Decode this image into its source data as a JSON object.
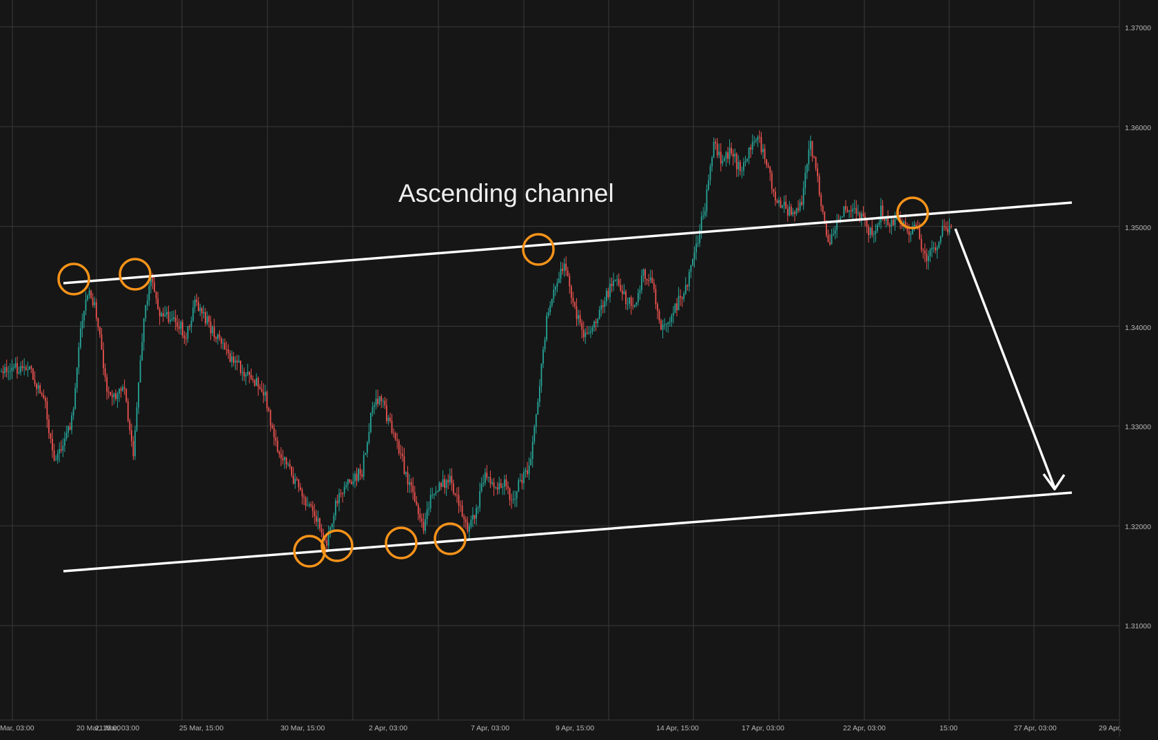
{
  "colors": {
    "background": "#161616",
    "grid": "#3a3a3a",
    "axis_text": "#b8b8b8",
    "bull_candle": "#26a69a",
    "bear_candle": "#ef5350",
    "channel_line": "#ffffff",
    "touch_marker": "#f7931a",
    "annotation_text": "#eeeeee"
  },
  "chart_data": {
    "type": "candlestick",
    "title": "",
    "annotations": [
      {
        "text": "Ascending channel"
      }
    ],
    "y_axis": {
      "position": "right",
      "range": [
        1.3,
        1.372
      ],
      "ticks": [
        "1.37000",
        "1.36000",
        "1.35000",
        "1.34000",
        "1.33000",
        "1.32000",
        "1.31000"
      ]
    },
    "x_axis": {
      "labels": [
        "Mar, 03:00",
        "20 Mar, 15:00",
        "21 Mar, 03:00",
        "25 Mar, 15:00",
        "30 Mar, 15:00",
        "2 Apr, 03:00",
        "7 Apr, 03:00",
        "9 Apr, 15:00",
        "14 Apr, 15:00",
        "17 Apr, 03:00",
        "22 Apr, 03:00",
        "15:00",
        "27 Apr, 03:00",
        "29 Apr,"
      ]
    },
    "grid": true,
    "price_path": [
      [
        0,
        1.3355
      ],
      [
        3,
        1.336
      ],
      [
        5,
        1.332
      ],
      [
        6,
        1.3265
      ],
      [
        7,
        1.3285
      ],
      [
        8,
        1.3305
      ],
      [
        9,
        1.3395
      ],
      [
        10,
        1.344
      ],
      [
        11,
        1.3405
      ],
      [
        12,
        1.333
      ],
      [
        14,
        1.3335
      ],
      [
        15,
        1.327
      ],
      [
        16,
        1.339
      ],
      [
        17,
        1.3455
      ],
      [
        18,
        1.3415
      ],
      [
        20,
        1.3405
      ],
      [
        21,
        1.339
      ],
      [
        22,
        1.3425
      ],
      [
        24,
        1.3395
      ],
      [
        26,
        1.337
      ],
      [
        28,
        1.335
      ],
      [
        29,
        1.3345
      ],
      [
        30,
        1.333
      ],
      [
        31,
        1.3285
      ],
      [
        33,
        1.325
      ],
      [
        35,
        1.322
      ],
      [
        36,
        1.3205
      ],
      [
        37,
        1.318
      ],
      [
        38,
        1.3225
      ],
      [
        39,
        1.324
      ],
      [
        41,
        1.3255
      ],
      [
        42,
        1.331
      ],
      [
        43,
        1.333
      ],
      [
        44,
        1.3305
      ],
      [
        45,
        1.3285
      ],
      [
        46,
        1.325
      ],
      [
        47,
        1.3225
      ],
      [
        48,
        1.3195
      ],
      [
        49,
        1.3235
      ],
      [
        50,
        1.324
      ],
      [
        51,
        1.3245
      ],
      [
        52,
        1.322
      ],
      [
        53,
        1.32
      ],
      [
        54,
        1.3215
      ],
      [
        55,
        1.3255
      ],
      [
        56,
        1.324
      ],
      [
        57,
        1.3245
      ],
      [
        58,
        1.3225
      ],
      [
        59,
        1.3245
      ],
      [
        60,
        1.3255
      ],
      [
        61,
        1.3325
      ],
      [
        62,
        1.3405
      ],
      [
        63,
        1.344
      ],
      [
        64,
        1.3465
      ],
      [
        65,
        1.3425
      ],
      [
        66,
        1.3395
      ],
      [
        67,
        1.339
      ],
      [
        68,
        1.3415
      ],
      [
        69,
        1.3435
      ],
      [
        70,
        1.345
      ],
      [
        71,
        1.3425
      ],
      [
        72,
        1.342
      ],
      [
        73,
        1.3455
      ],
      [
        74,
        1.3445
      ],
      [
        75,
        1.3395
      ],
      [
        76,
        1.3405
      ],
      [
        77,
        1.3425
      ],
      [
        78,
        1.3445
      ],
      [
        79,
        1.348
      ],
      [
        80,
        1.352
      ],
      [
        81,
        1.3585
      ],
      [
        82,
        1.3565
      ],
      [
        83,
        1.3575
      ],
      [
        84,
        1.3555
      ],
      [
        85,
        1.3575
      ],
      [
        86,
        1.359
      ],
      [
        87,
        1.356
      ],
      [
        88,
        1.353
      ],
      [
        89,
        1.352
      ],
      [
        90,
        1.351
      ],
      [
        91,
        1.3525
      ],
      [
        92,
        1.3585
      ],
      [
        93,
        1.3535
      ],
      [
        94,
        1.3485
      ],
      [
        95,
        1.35
      ],
      [
        96,
        1.352
      ],
      [
        97,
        1.352
      ],
      [
        98,
        1.3505
      ],
      [
        99,
        1.349
      ],
      [
        100,
        1.3515
      ],
      [
        101,
        1.3505
      ],
      [
        102,
        1.351
      ],
      [
        103,
        1.3495
      ],
      [
        104,
        1.35
      ],
      [
        105,
        1.347
      ],
      [
        106,
        1.3475
      ],
      [
        107,
        1.3495
      ],
      [
        108,
        1.35
      ]
    ]
  }
}
